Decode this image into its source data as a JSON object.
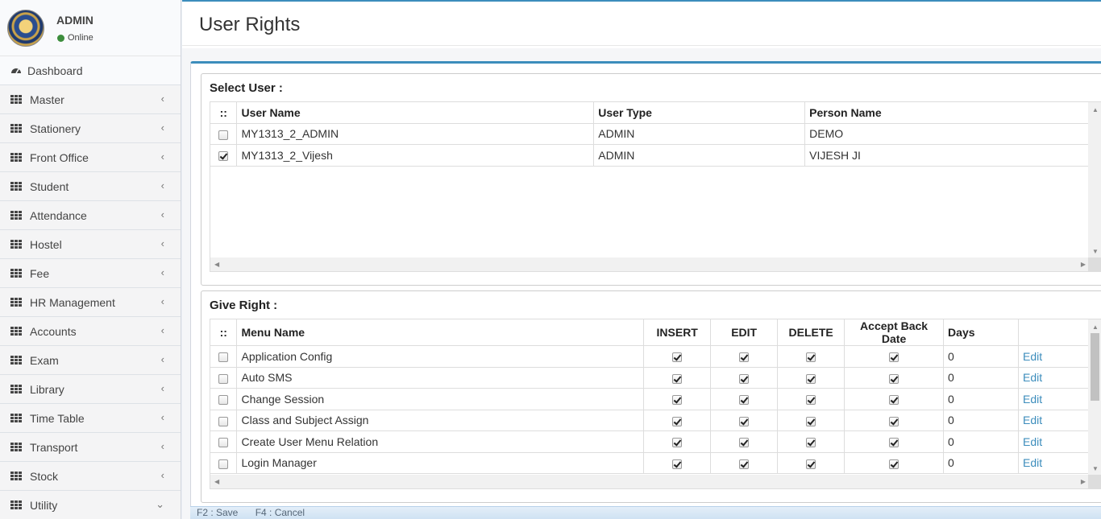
{
  "user": {
    "name": "ADMIN",
    "status": "Online"
  },
  "sidebar": {
    "items": [
      {
        "label": "Dashboard"
      },
      {
        "label": "Master"
      },
      {
        "label": "Stationery"
      },
      {
        "label": "Front Office"
      },
      {
        "label": "Student"
      },
      {
        "label": "Attendance"
      },
      {
        "label": "Hostel"
      },
      {
        "label": "Fee"
      },
      {
        "label": "HR Management"
      },
      {
        "label": "Accounts"
      },
      {
        "label": "Exam"
      },
      {
        "label": "Library"
      },
      {
        "label": "Time Table"
      },
      {
        "label": "Transport"
      },
      {
        "label": "Stock"
      },
      {
        "label": "Utility"
      }
    ]
  },
  "page": {
    "title": "User Rights"
  },
  "select_user": {
    "title": "Select User :",
    "columns": [
      "::",
      "User Name",
      "User Type",
      "Person Name"
    ],
    "rows": [
      {
        "checked": false,
        "user_name": "MY1313_2_ADMIN",
        "user_type": "ADMIN",
        "person_name": "DEMO"
      },
      {
        "checked": true,
        "user_name": "MY1313_2_Vijesh",
        "user_type": "ADMIN",
        "person_name": "VIJESH JI"
      }
    ]
  },
  "give_right": {
    "title": "Give Right :",
    "columns": [
      "::",
      "Menu Name",
      "INSERT",
      "EDIT",
      "DELETE",
      "Accept Back Date",
      "Days",
      ""
    ],
    "edit_label": "Edit",
    "rows": [
      {
        "menu": "Application Config",
        "days": "0"
      },
      {
        "menu": "Auto SMS",
        "days": "0"
      },
      {
        "menu": "Change Session",
        "days": "0"
      },
      {
        "menu": "Class and Subject Assign",
        "days": "0"
      },
      {
        "menu": "Create User Menu Relation",
        "days": "0"
      },
      {
        "menu": "Login Manager",
        "days": "0"
      }
    ]
  },
  "footer": {
    "save": "F2 : Save",
    "cancel": "F4 : Cancel"
  }
}
